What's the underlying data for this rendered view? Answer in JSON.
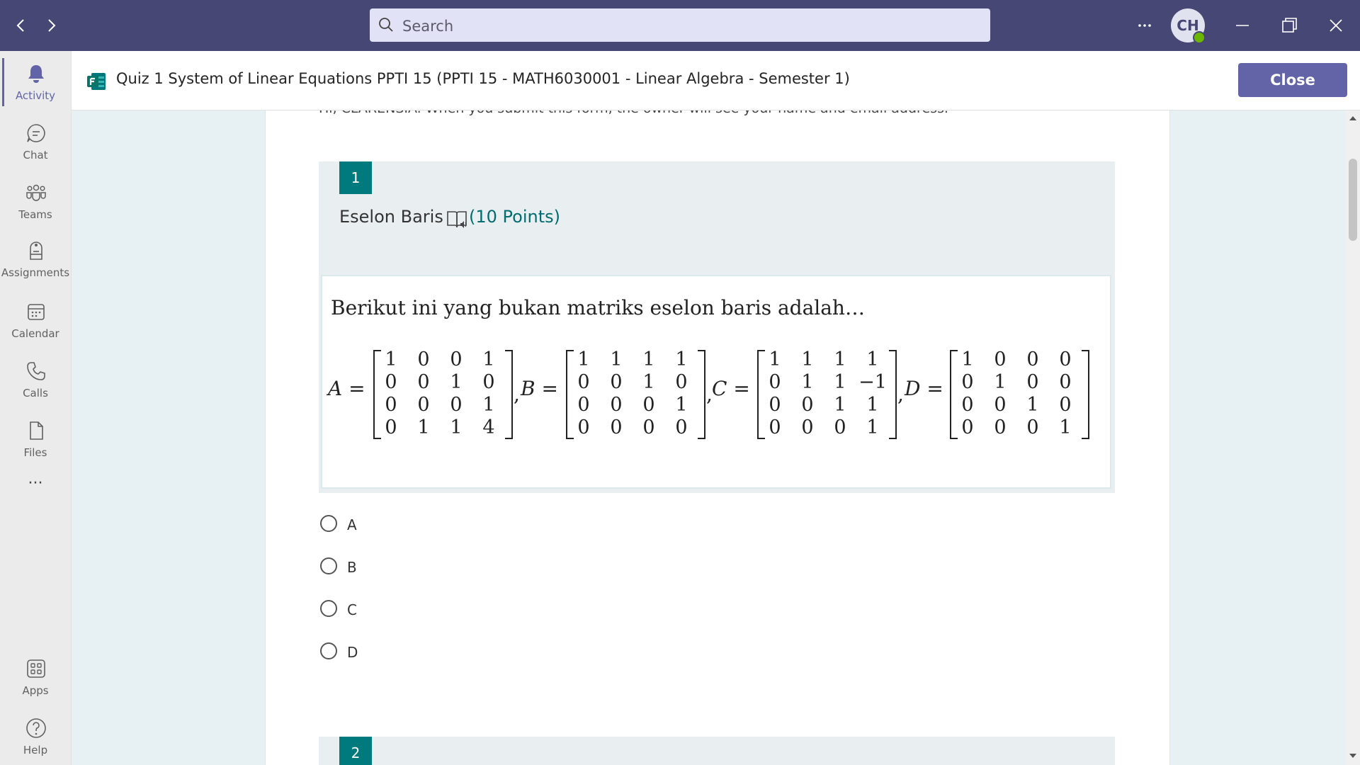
{
  "titlebar": {
    "search_placeholder": "Search",
    "avatar_initials": "CH",
    "more_label": "···"
  },
  "rail": {
    "items": [
      {
        "label": "Activity",
        "icon": "bell-icon"
      },
      {
        "label": "Chat",
        "icon": "chat-icon"
      },
      {
        "label": "Teams",
        "icon": "teams-icon"
      },
      {
        "label": "Assignments",
        "icon": "assignments-icon"
      },
      {
        "label": "Calendar",
        "icon": "calendar-icon"
      },
      {
        "label": "Calls",
        "icon": "phone-icon"
      },
      {
        "label": "Files",
        "icon": "file-icon"
      },
      {
        "label": "Apps",
        "icon": "apps-icon"
      },
      {
        "label": "Help",
        "icon": "help-icon"
      }
    ],
    "more_label": "···",
    "active": "Activity"
  },
  "app_header": {
    "title": "Quiz 1 System of Linear Equations PPTI 15 (PPTI 15 - MATH6030001 - Linear Algebra - Semester 1)",
    "close_label": "Close"
  },
  "form": {
    "greeting": "Hi, CLARENSIA. When you submit this form, the owner will see your name and email address.",
    "question1": {
      "number": "1",
      "title": "Eselon Baris",
      "points": "(10 Points)",
      "prompt": "Berikut ini yang bukan matriks eselon baris adalah…",
      "matrices": [
        {
          "name": "A =",
          "rows": [
            [
              "1",
              "0",
              "0",
              "1"
            ],
            [
              "0",
              "0",
              "1",
              "0"
            ],
            [
              "0",
              "0",
              "0",
              "1"
            ],
            [
              "0",
              "1",
              "1",
              "4"
            ]
          ]
        },
        {
          "name": "B =",
          "rows": [
            [
              "1",
              "1",
              "1",
              "1"
            ],
            [
              "0",
              "0",
              "1",
              "0"
            ],
            [
              "0",
              "0",
              "0",
              "1"
            ],
            [
              "0",
              "0",
              "0",
              "0"
            ]
          ]
        },
        {
          "name": "C =",
          "rows": [
            [
              "1",
              "1",
              "1",
              "1"
            ],
            [
              "0",
              "1",
              "1",
              "−1"
            ],
            [
              "0",
              "0",
              "1",
              "1"
            ],
            [
              "0",
              "0",
              "0",
              "1"
            ]
          ]
        },
        {
          "name": "D =",
          "rows": [
            [
              "1",
              "0",
              "0",
              "0"
            ],
            [
              "0",
              "1",
              "0",
              "0"
            ],
            [
              "0",
              "0",
              "1",
              "0"
            ],
            [
              "0",
              "0",
              "0",
              "1"
            ]
          ]
        }
      ],
      "options": [
        "A",
        "B",
        "C",
        "D"
      ]
    },
    "question2": {
      "number": "2"
    }
  },
  "colors": {
    "titlebar": "#464775",
    "accent": "#6264a7",
    "question_number": "#007a7c",
    "points_text": "#036c70"
  }
}
